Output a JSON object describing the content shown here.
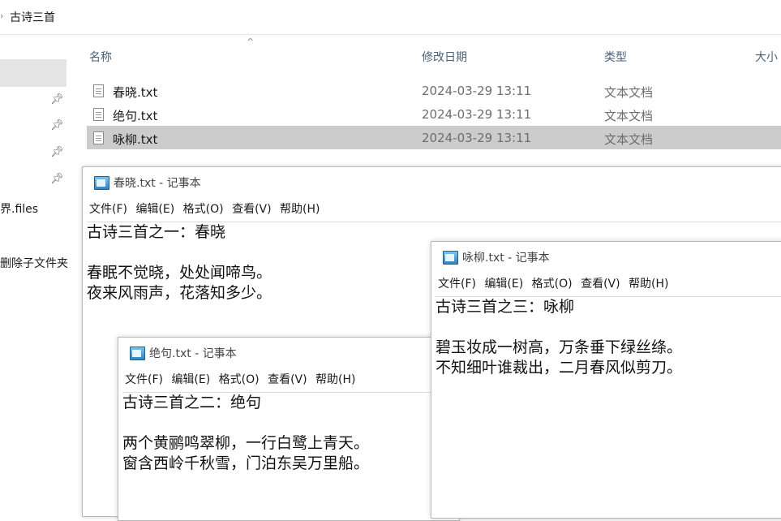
{
  "explorer": {
    "breadcrumb": "古诗三首",
    "sidebar_labels": [
      "界.files",
      "删除子文件夹"
    ],
    "columns": {
      "name": "名称",
      "date": "修改日期",
      "type": "类型",
      "size": "大小"
    },
    "files": [
      {
        "name": "春晓.txt",
        "date": "2024-03-29 13:11",
        "type": "文本文档"
      },
      {
        "name": "绝句.txt",
        "date": "2024-03-29 13:11",
        "type": "文本文档"
      },
      {
        "name": "咏柳.txt",
        "date": "2024-03-29 13:11",
        "type": "文本文档"
      }
    ]
  },
  "menu": {
    "file": "文件(F)",
    "edit": "编辑(E)",
    "format": "格式(O)",
    "view": "查看(V)",
    "help": "帮助(H)"
  },
  "notepads": {
    "chunxiao": {
      "title": "春晓.txt - 记事本",
      "lines": [
        "古诗三首之一：春晓",
        "",
        "春眠不觉晓，处处闻啼鸟。",
        "夜来风雨声，花落知多少。"
      ]
    },
    "jueju": {
      "title": "绝句.txt - 记事本",
      "lines": [
        "古诗三首之二：绝句",
        "",
        "两个黄鹂鸣翠柳，一行白鹭上青天。",
        "窗含西岭千秋雪，门泊东吴万里船。"
      ]
    },
    "yongliu": {
      "title": "咏柳.txt - 记事本",
      "lines": [
        "古诗三首之三：咏柳",
        "",
        "碧玉妆成一树高，万条垂下绿丝绦。",
        "不知细叶谁裁出，二月春风似剪刀。"
      ]
    }
  }
}
